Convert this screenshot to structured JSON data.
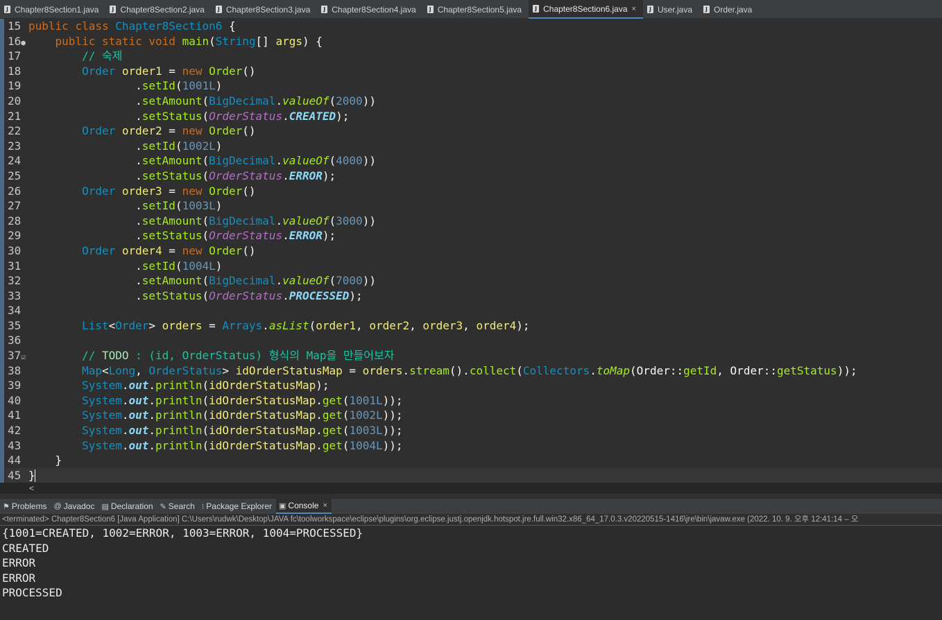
{
  "editor_tabs": [
    {
      "label": "Chapter8Section1.java"
    },
    {
      "label": "Chapter8Section2.java"
    },
    {
      "label": "Chapter8Section3.java"
    },
    {
      "label": "Chapter8Section4.java"
    },
    {
      "label": "Chapter8Section5.java"
    },
    {
      "label": "Chapter8Section6.java",
      "active": true,
      "close": "×"
    },
    {
      "label": "User.java"
    },
    {
      "label": "Order.java"
    }
  ],
  "code_lines": [
    {
      "n": "15",
      "tokens": [
        [
          "k",
          "public "
        ],
        [
          "k",
          "class "
        ],
        [
          "ty",
          "Chapter8Section6 "
        ],
        [
          "p",
          "{"
        ]
      ]
    },
    {
      "n": "16",
      "marker": "●",
      "tokens": [
        [
          "p",
          "    "
        ],
        [
          "k",
          "public "
        ],
        [
          "k",
          "static "
        ],
        [
          "k",
          "void "
        ],
        [
          "m",
          "main"
        ],
        [
          "p",
          "("
        ],
        [
          "ty",
          "String"
        ],
        [
          "p",
          "[] "
        ],
        [
          "vr",
          "args"
        ],
        [
          "p",
          ") {"
        ]
      ]
    },
    {
      "n": "17",
      "tokens": [
        [
          "p",
          "        "
        ],
        [
          "c",
          "// 숙제"
        ]
      ]
    },
    {
      "n": "18",
      "tokens": [
        [
          "p",
          "        "
        ],
        [
          "ty",
          "Order "
        ],
        [
          "vr",
          "order1 "
        ],
        [
          "p",
          "= "
        ],
        [
          "k",
          "new "
        ],
        [
          "m",
          "Order"
        ],
        [
          "p",
          "()"
        ]
      ]
    },
    {
      "n": "19",
      "tokens": [
        [
          "p",
          "                ."
        ],
        [
          "m",
          "setId"
        ],
        [
          "p",
          "("
        ],
        [
          "n",
          "1001L"
        ],
        [
          "p",
          ")"
        ]
      ]
    },
    {
      "n": "20",
      "tokens": [
        [
          "p",
          "                ."
        ],
        [
          "m",
          "setAmount"
        ],
        [
          "p",
          "("
        ],
        [
          "ty",
          "BigDecimal"
        ],
        [
          "p",
          "."
        ],
        [
          "mi",
          "valueOf"
        ],
        [
          "p",
          "("
        ],
        [
          "n",
          "2000"
        ],
        [
          "p",
          "))"
        ]
      ]
    },
    {
      "n": "21",
      "tokens": [
        [
          "p",
          "                ."
        ],
        [
          "m",
          "setStatus"
        ],
        [
          "p",
          "("
        ],
        [
          "st",
          "OrderStatus"
        ],
        [
          "p",
          "."
        ],
        [
          "en",
          "CREATED"
        ],
        [
          "p",
          ");"
        ]
      ]
    },
    {
      "n": "22",
      "tokens": [
        [
          "p",
          "        "
        ],
        [
          "ty",
          "Order "
        ],
        [
          "vr",
          "order2 "
        ],
        [
          "p",
          "= "
        ],
        [
          "k",
          "new "
        ],
        [
          "m",
          "Order"
        ],
        [
          "p",
          "()"
        ]
      ]
    },
    {
      "n": "23",
      "tokens": [
        [
          "p",
          "                ."
        ],
        [
          "m",
          "setId"
        ],
        [
          "p",
          "("
        ],
        [
          "n",
          "1002L"
        ],
        [
          "p",
          ")"
        ]
      ]
    },
    {
      "n": "24",
      "tokens": [
        [
          "p",
          "                ."
        ],
        [
          "m",
          "setAmount"
        ],
        [
          "p",
          "("
        ],
        [
          "ty",
          "BigDecimal"
        ],
        [
          "p",
          "."
        ],
        [
          "mi",
          "valueOf"
        ],
        [
          "p",
          "("
        ],
        [
          "n",
          "4000"
        ],
        [
          "p",
          "))"
        ]
      ]
    },
    {
      "n": "25",
      "tokens": [
        [
          "p",
          "                ."
        ],
        [
          "m",
          "setStatus"
        ],
        [
          "p",
          "("
        ],
        [
          "st",
          "OrderStatus"
        ],
        [
          "p",
          "."
        ],
        [
          "en",
          "ERROR"
        ],
        [
          "p",
          ");"
        ]
      ]
    },
    {
      "n": "26",
      "tokens": [
        [
          "p",
          "        "
        ],
        [
          "ty",
          "Order "
        ],
        [
          "vr",
          "order3 "
        ],
        [
          "p",
          "= "
        ],
        [
          "k",
          "new "
        ],
        [
          "m",
          "Order"
        ],
        [
          "p",
          "()"
        ]
      ]
    },
    {
      "n": "27",
      "tokens": [
        [
          "p",
          "                ."
        ],
        [
          "m",
          "setId"
        ],
        [
          "p",
          "("
        ],
        [
          "n",
          "1003L"
        ],
        [
          "p",
          ")"
        ]
      ]
    },
    {
      "n": "28",
      "tokens": [
        [
          "p",
          "                ."
        ],
        [
          "m",
          "setAmount"
        ],
        [
          "p",
          "("
        ],
        [
          "ty",
          "BigDecimal"
        ],
        [
          "p",
          "."
        ],
        [
          "mi",
          "valueOf"
        ],
        [
          "p",
          "("
        ],
        [
          "n",
          "3000"
        ],
        [
          "p",
          "))"
        ]
      ]
    },
    {
      "n": "29",
      "tokens": [
        [
          "p",
          "                ."
        ],
        [
          "m",
          "setStatus"
        ],
        [
          "p",
          "("
        ],
        [
          "st",
          "OrderStatus"
        ],
        [
          "p",
          "."
        ],
        [
          "en",
          "ERROR"
        ],
        [
          "p",
          ");"
        ]
      ]
    },
    {
      "n": "30",
      "tokens": [
        [
          "p",
          "        "
        ],
        [
          "ty",
          "Order "
        ],
        [
          "vr",
          "order4 "
        ],
        [
          "p",
          "= "
        ],
        [
          "k",
          "new "
        ],
        [
          "m",
          "Order"
        ],
        [
          "p",
          "()"
        ]
      ]
    },
    {
      "n": "31",
      "tokens": [
        [
          "p",
          "                ."
        ],
        [
          "m",
          "setId"
        ],
        [
          "p",
          "("
        ],
        [
          "n",
          "1004L"
        ],
        [
          "p",
          ")"
        ]
      ]
    },
    {
      "n": "32",
      "tokens": [
        [
          "p",
          "                ."
        ],
        [
          "m",
          "setAmount"
        ],
        [
          "p",
          "("
        ],
        [
          "ty",
          "BigDecimal"
        ],
        [
          "p",
          "."
        ],
        [
          "mi",
          "valueOf"
        ],
        [
          "p",
          "("
        ],
        [
          "n",
          "7000"
        ],
        [
          "p",
          "))"
        ]
      ]
    },
    {
      "n": "33",
      "tokens": [
        [
          "p",
          "                ."
        ],
        [
          "m",
          "setStatus"
        ],
        [
          "p",
          "("
        ],
        [
          "st",
          "OrderStatus"
        ],
        [
          "p",
          "."
        ],
        [
          "en",
          "PROCESSED"
        ],
        [
          "p",
          ");"
        ]
      ]
    },
    {
      "n": "34",
      "tokens": []
    },
    {
      "n": "35",
      "tokens": [
        [
          "p",
          "        "
        ],
        [
          "ty",
          "List"
        ],
        [
          "p",
          "<"
        ],
        [
          "ty",
          "Order"
        ],
        [
          "p",
          "> "
        ],
        [
          "vr",
          "orders "
        ],
        [
          "p",
          "= "
        ],
        [
          "ty",
          "Arrays"
        ],
        [
          "p",
          "."
        ],
        [
          "mi",
          "asList"
        ],
        [
          "p",
          "("
        ],
        [
          "vr",
          "order1"
        ],
        [
          "p",
          ", "
        ],
        [
          "vr",
          "order2"
        ],
        [
          "p",
          ", "
        ],
        [
          "vr",
          "order3"
        ],
        [
          "p",
          ", "
        ],
        [
          "vr",
          "order4"
        ],
        [
          "p",
          ");"
        ]
      ]
    },
    {
      "n": "36",
      "tokens": []
    },
    {
      "n": "37",
      "marker": "☑",
      "tokens": [
        [
          "p",
          "        "
        ],
        [
          "c",
          "// "
        ],
        [
          "cb",
          "TODO"
        ],
        [
          "c",
          " : (id, OrderStatus) 형식의 Map을 만들어보자"
        ]
      ]
    },
    {
      "n": "38",
      "tokens": [
        [
          "p",
          "        "
        ],
        [
          "ty",
          "Map"
        ],
        [
          "p",
          "<"
        ],
        [
          "ty",
          "Long"
        ],
        [
          "p",
          ", "
        ],
        [
          "ty",
          "OrderStatus"
        ],
        [
          "p",
          "> "
        ],
        [
          "vr",
          "idOrderStatusMap "
        ],
        [
          "p",
          "= "
        ],
        [
          "vr",
          "orders"
        ],
        [
          "p",
          "."
        ],
        [
          "m",
          "stream"
        ],
        [
          "p",
          "()."
        ],
        [
          "m",
          "collect"
        ],
        [
          "p",
          "("
        ],
        [
          "ty",
          "Collectors"
        ],
        [
          "p",
          "."
        ],
        [
          "mi",
          "toMap"
        ],
        [
          "p",
          "("
        ],
        [
          "p",
          "Order::"
        ],
        [
          "m",
          "getId"
        ],
        [
          "p",
          ", "
        ],
        [
          "p",
          "Order::"
        ],
        [
          "m",
          "getStatus"
        ],
        [
          "p",
          "));"
        ]
      ]
    },
    {
      "n": "39",
      "tokens": [
        [
          "p",
          "        "
        ],
        [
          "ty",
          "System"
        ],
        [
          "p",
          "."
        ],
        [
          "fo",
          "out"
        ],
        [
          "p",
          "."
        ],
        [
          "m",
          "println"
        ],
        [
          "p",
          "("
        ],
        [
          "vr",
          "idOrderStatusMap"
        ],
        [
          "p",
          ");"
        ]
      ]
    },
    {
      "n": "40",
      "tokens": [
        [
          "p",
          "        "
        ],
        [
          "ty",
          "System"
        ],
        [
          "p",
          "."
        ],
        [
          "fo",
          "out"
        ],
        [
          "p",
          "."
        ],
        [
          "m",
          "println"
        ],
        [
          "p",
          "("
        ],
        [
          "vr",
          "idOrderStatusMap"
        ],
        [
          "p",
          "."
        ],
        [
          "m",
          "get"
        ],
        [
          "p",
          "("
        ],
        [
          "n",
          "1001L"
        ],
        [
          "p",
          "));"
        ]
      ]
    },
    {
      "n": "41",
      "tokens": [
        [
          "p",
          "        "
        ],
        [
          "ty",
          "System"
        ],
        [
          "p",
          "."
        ],
        [
          "fo",
          "out"
        ],
        [
          "p",
          "."
        ],
        [
          "m",
          "println"
        ],
        [
          "p",
          "("
        ],
        [
          "vr",
          "idOrderStatusMap"
        ],
        [
          "p",
          "."
        ],
        [
          "m",
          "get"
        ],
        [
          "p",
          "("
        ],
        [
          "n",
          "1002L"
        ],
        [
          "p",
          "));"
        ]
      ]
    },
    {
      "n": "42",
      "tokens": [
        [
          "p",
          "        "
        ],
        [
          "ty",
          "System"
        ],
        [
          "p",
          "."
        ],
        [
          "fo",
          "out"
        ],
        [
          "p",
          "."
        ],
        [
          "m",
          "println"
        ],
        [
          "p",
          "("
        ],
        [
          "vr",
          "idOrderStatusMap"
        ],
        [
          "p",
          "."
        ],
        [
          "m",
          "get"
        ],
        [
          "p",
          "("
        ],
        [
          "n",
          "1003L"
        ],
        [
          "p",
          "));"
        ]
      ]
    },
    {
      "n": "43",
      "tokens": [
        [
          "p",
          "        "
        ],
        [
          "ty",
          "System"
        ],
        [
          "p",
          "."
        ],
        [
          "fo",
          "out"
        ],
        [
          "p",
          "."
        ],
        [
          "m",
          "println"
        ],
        [
          "p",
          "("
        ],
        [
          "vr",
          "idOrderStatusMap"
        ],
        [
          "p",
          "."
        ],
        [
          "m",
          "get"
        ],
        [
          "p",
          "("
        ],
        [
          "n",
          "1004L"
        ],
        [
          "p",
          "));"
        ]
      ]
    },
    {
      "n": "44",
      "tokens": [
        [
          "p",
          "    }"
        ]
      ]
    },
    {
      "n": "45",
      "current": true,
      "tokens": [
        [
          "p",
          "}"
        ]
      ]
    }
  ],
  "scroll_arrow": "<",
  "view_tabs": [
    {
      "label": "Problems",
      "icon": "⚑",
      "icon_name": "problems-icon"
    },
    {
      "label": "Javadoc",
      "icon": "@",
      "icon_name": "javadoc-icon"
    },
    {
      "label": "Declaration",
      "icon": "▤",
      "icon_name": "declaration-icon"
    },
    {
      "label": "Search",
      "icon": "✎",
      "icon_name": "search-icon"
    },
    {
      "label": "Package Explorer",
      "icon": "⁝",
      "icon_name": "package-explorer-icon"
    },
    {
      "label": "Console",
      "icon": "▣",
      "icon_name": "console-icon",
      "active": true,
      "close": "×"
    }
  ],
  "console_status": "<terminated> Chapter8Section6 [Java Application] C:\\Users\\rudwk\\Desktop\\JAVA fc\\toolworkspace\\eclipse\\plugins\\org.eclipse.justj.openjdk.hotspot.jre.full.win32.x86_64_17.0.3.v20220515-1416\\jre\\bin\\javaw.exe  (2022. 10. 9. 오후 12:41:14 – 오",
  "console_output": [
    "{1001=CREATED, 1002=ERROR, 1003=ERROR, 1004=PROCESSED}",
    "CREATED",
    "ERROR",
    "ERROR",
    "PROCESSED"
  ]
}
